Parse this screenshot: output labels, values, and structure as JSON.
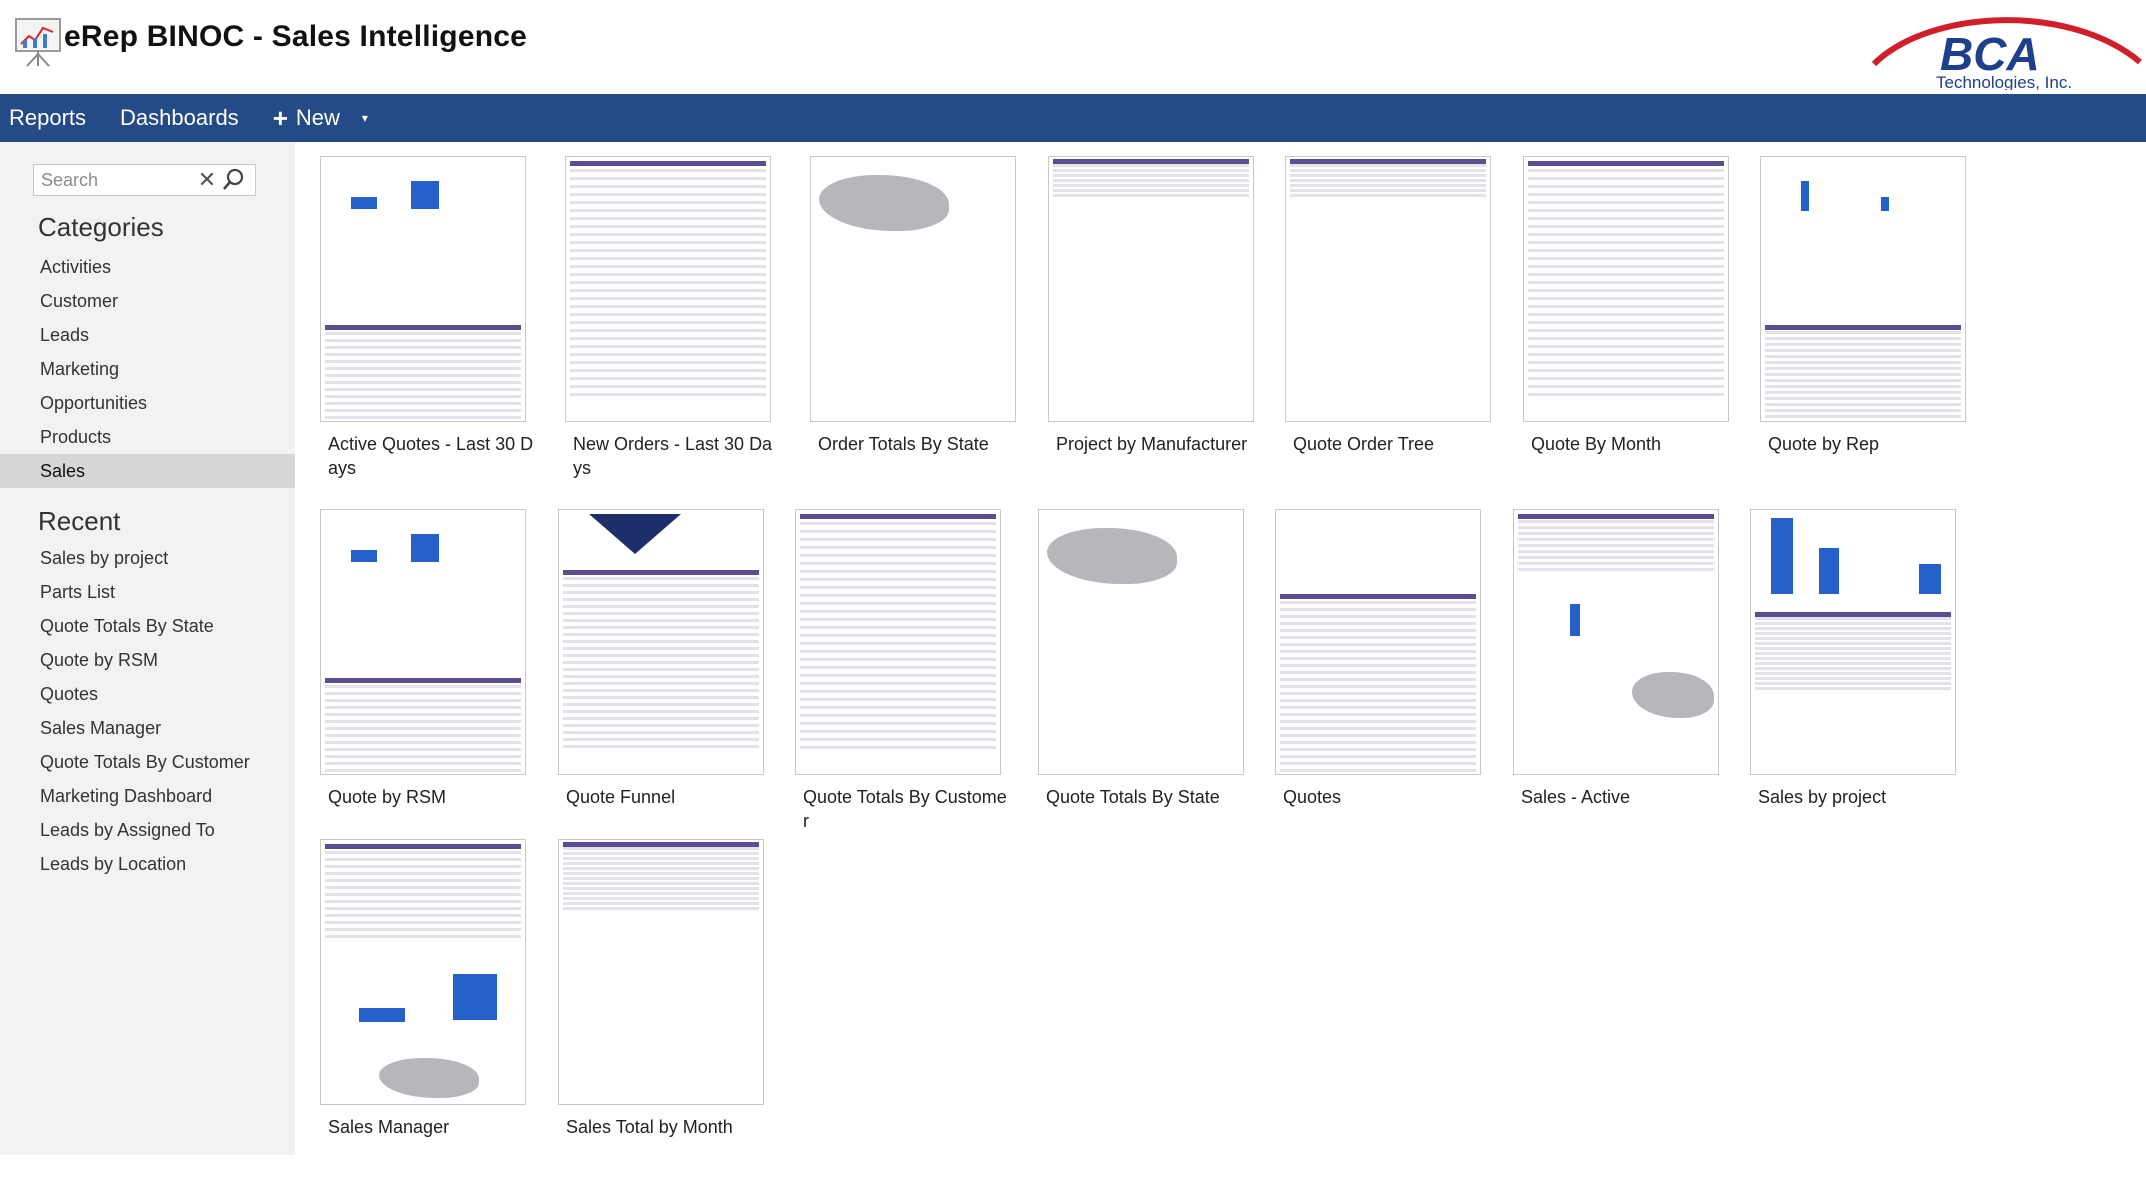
{
  "app": {
    "title": "eRep BINOC - Sales Intelligence",
    "logo_icon": "easel-chart-icon"
  },
  "brand": {
    "name": "BCA",
    "tagline": "Technologies, Inc.",
    "arc_color": "#d01f2a",
    "text_color": "#1e3f8c"
  },
  "nav": {
    "background": "#244b87",
    "reports": "Reports",
    "dashboards": "Dashboards",
    "new": "New"
  },
  "search": {
    "placeholder": "Search"
  },
  "categories": {
    "heading": "Categories",
    "items": [
      "Activities",
      "Customer",
      "Leads",
      "Marketing",
      "Opportunities",
      "Products",
      "Sales"
    ],
    "active": "Sales"
  },
  "recent": {
    "heading": "Recent",
    "items": [
      "Sales by project",
      "Parts List",
      "Quote Totals By State",
      "Quote by RSM",
      "Quotes",
      "Sales Manager",
      "Quote Totals By Customer",
      "Marketing Dashboard",
      "Leads by Assigned To",
      "Leads by Location"
    ]
  },
  "reports": [
    {
      "label": "Active Quotes - Last 30 Days",
      "thumb": "bar-table"
    },
    {
      "label": "New Orders - Last 30 Days",
      "thumb": "table"
    },
    {
      "label": "Order Totals By State",
      "thumb": "map"
    },
    {
      "label": "Project by Manufacturer",
      "thumb": "small-table"
    },
    {
      "label": "Quote Order Tree",
      "thumb": "small-table"
    },
    {
      "label": "Quote By Month",
      "thumb": "table"
    },
    {
      "label": "Quote by Rep",
      "thumb": "line-table"
    },
    {
      "label": "Quote by RSM",
      "thumb": "bar-table"
    },
    {
      "label": "Quote Funnel",
      "thumb": "funnel"
    },
    {
      "label": "Quote Totals By Customer",
      "thumb": "table"
    },
    {
      "label": "Quote Totals By State",
      "thumb": "map"
    },
    {
      "label": "Quotes",
      "thumb": "pie-table"
    },
    {
      "label": "Sales - Active",
      "thumb": "table-line-map"
    },
    {
      "label": "Sales by project",
      "thumb": "bars-table"
    },
    {
      "label": "Sales Manager",
      "thumb": "table-bar-map"
    },
    {
      "label": "Sales Total by Month",
      "thumb": "narrow-table"
    }
  ]
}
